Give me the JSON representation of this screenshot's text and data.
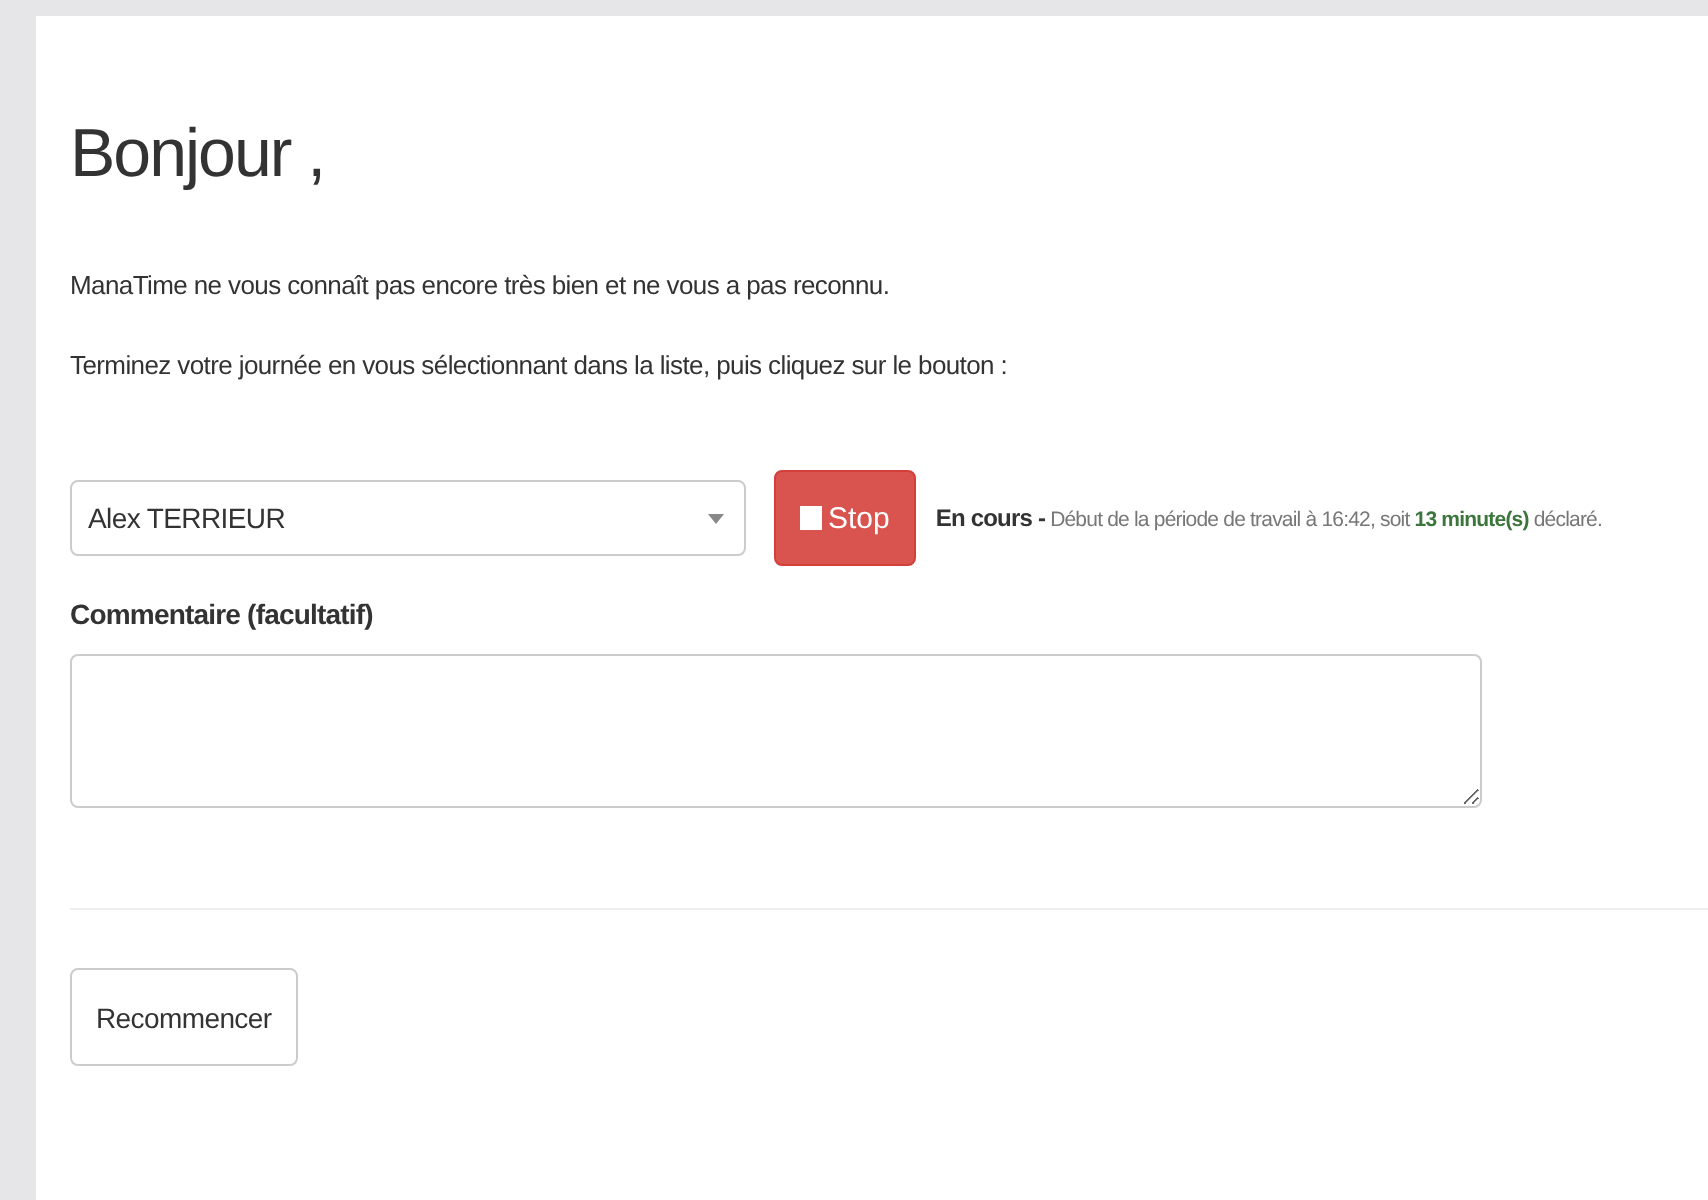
{
  "heading": "Bonjour ,",
  "paragraphs": [
    "ManaTime ne vous connaît pas encore très bien et ne vous a pas reconnu.",
    "Terminez votre journée en vous sélectionnant dans la liste, puis cliquez sur le bouton :"
  ],
  "user_select": {
    "value": "Alex TERRIEUR"
  },
  "stop_button": {
    "label": "Stop"
  },
  "status": {
    "label": "En cours -",
    "text_before": "Début de la période de travail à 16:42, soit",
    "highlight": "13 minute(s)",
    "text_after": "déclaré."
  },
  "comment": {
    "label": "Commentaire (facultatif)"
  },
  "restart_button": {
    "label": "Recommencer"
  }
}
